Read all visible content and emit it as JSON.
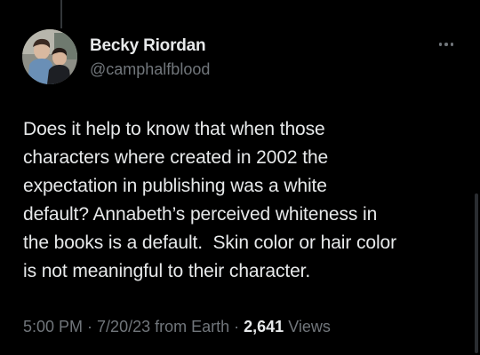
{
  "author": {
    "display_name": "Becky Riordan",
    "handle": "@camphalfblood"
  },
  "icons": {
    "more": "more-horizontal-icon"
  },
  "tweet": {
    "lines": [
      "Does it help to know that when those",
      "characters where created in 2002 the",
      "expectation in publishing was a white",
      "default? Annabeth’s perceived whiteness in",
      "the books is a default.  Skin color or hair color",
      "is not meaningful to their character."
    ]
  },
  "meta": {
    "time": "5:00 PM",
    "separator": " · ",
    "date": "7/20/23",
    "source": " from Earth",
    "views_count": "2,641",
    "views_label": " Views"
  },
  "colors": {
    "background": "#000000",
    "primary_text": "#e7e9ea",
    "secondary_text": "#71767b"
  }
}
